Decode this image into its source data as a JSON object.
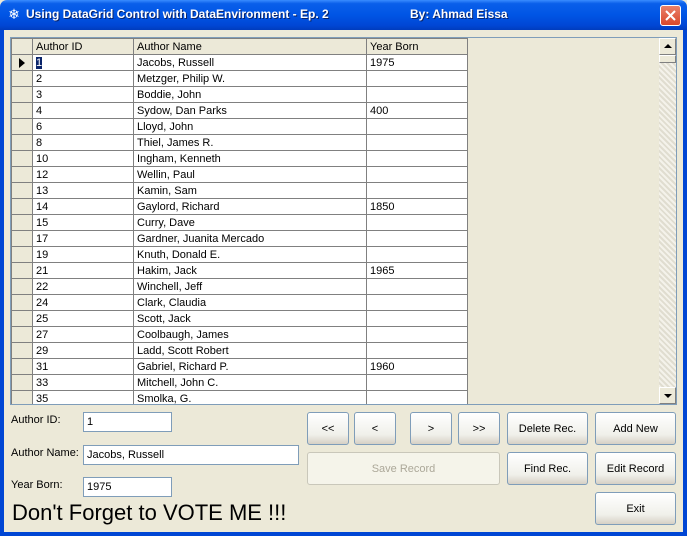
{
  "window": {
    "title": "Using DataGrid Control with DataEnvironment - Ep. 2",
    "author": "By: Ahmad Eissa",
    "title_icon": "snowflake-icon",
    "close_icon": "close-icon"
  },
  "grid": {
    "columns": [
      "Author ID",
      "Author Name",
      "Year Born"
    ],
    "selected_row": 0,
    "rows": [
      [
        "1",
        "Jacobs, Russell",
        "1975"
      ],
      [
        "2",
        "Metzger, Philip W.",
        ""
      ],
      [
        "3",
        "Boddie, John",
        ""
      ],
      [
        "4",
        "Sydow, Dan Parks",
        "400"
      ],
      [
        "6",
        "Lloyd, John",
        ""
      ],
      [
        "8",
        "Thiel, James R.",
        ""
      ],
      [
        "10",
        "Ingham, Kenneth",
        ""
      ],
      [
        "12",
        "Wellin, Paul",
        ""
      ],
      [
        "13",
        "Kamin, Sam",
        ""
      ],
      [
        "14",
        "Gaylord, Richard",
        "1850"
      ],
      [
        "15",
        "Curry, Dave",
        ""
      ],
      [
        "17",
        "Gardner, Juanita Mercado",
        ""
      ],
      [
        "19",
        "Knuth, Donald E.",
        ""
      ],
      [
        "21",
        "Hakim, Jack",
        "1965"
      ],
      [
        "22",
        "Winchell, Jeff",
        ""
      ],
      [
        "24",
        "Clark, Claudia",
        ""
      ],
      [
        "25",
        "Scott, Jack",
        ""
      ],
      [
        "27",
        "Coolbaugh, James",
        ""
      ],
      [
        "29",
        "Ladd, Scott Robert",
        ""
      ],
      [
        "31",
        "Gabriel, Richard P.",
        "1960"
      ],
      [
        "33",
        "Mitchell, John C.",
        ""
      ],
      [
        "35",
        "Smolka, G.",
        ""
      ]
    ]
  },
  "form": {
    "author_id_label": "Author ID:",
    "author_id_value": "1",
    "author_name_label": "Author Name:",
    "author_name_value": "Jacobs, Russell",
    "year_born_label": "Year Born:",
    "year_born_value": "1975"
  },
  "buttons": {
    "first": "<<",
    "prev": "<",
    "next": ">",
    "last": ">>",
    "delete": "Delete Rec.",
    "add": "Add New",
    "save": "Save Record",
    "find": "Find Rec.",
    "edit": "Edit Record",
    "exit": "Exit"
  },
  "footer": {
    "vote_text": "Don't Forget to VOTE ME !!!"
  },
  "colors": {
    "titlebar": "#0055E5",
    "window_bg": "#ECE9D8",
    "selection": "#0A246A",
    "close_button": "#D9482A"
  }
}
